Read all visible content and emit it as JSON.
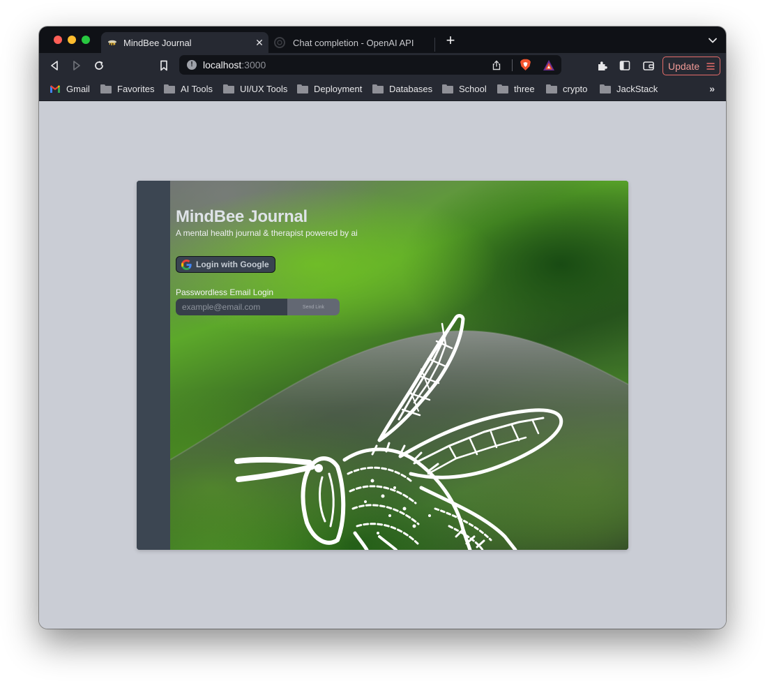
{
  "browser": {
    "tabs": [
      {
        "title": "MindBee Journal",
        "active": true
      },
      {
        "title": "Chat completion - OpenAI API",
        "active": false
      }
    ],
    "close_glyph": "✕",
    "newtab_glyph": "+",
    "address": {
      "host": "localhost",
      "port": ":3000",
      "info_glyph": "!"
    },
    "update_label": "Update",
    "bookmarks": [
      {
        "label": "Gmail",
        "icon": "gmail-icon"
      },
      {
        "label": "Favorites",
        "icon": "folder-icon"
      },
      {
        "label": "AI Tools",
        "icon": "folder-icon"
      },
      {
        "label": "UI/UX Tools",
        "icon": "folder-icon"
      },
      {
        "label": "Deployment",
        "icon": "folder-icon"
      },
      {
        "label": "Databases",
        "icon": "folder-icon"
      },
      {
        "label": "School",
        "icon": "folder-icon"
      },
      {
        "label": "three",
        "icon": "folder-icon"
      },
      {
        "label": "crypto",
        "icon": "folder-icon"
      },
      {
        "label": "JackStack",
        "icon": "folder-icon"
      }
    ],
    "bookmarks_more": "»"
  },
  "app": {
    "title": "MindBee Journal",
    "subtitle": "A mental health journal & therapist powered by ai",
    "google_login_label": "Login with Google",
    "email_label": "Passwordless Email Login",
    "email_placeholder": "example@email.com",
    "send_link_label": "Send Link"
  },
  "colors": {
    "accent_green": "#6ab82a",
    "update_accent": "#e66d6a",
    "page_background": "#cacdd5"
  }
}
